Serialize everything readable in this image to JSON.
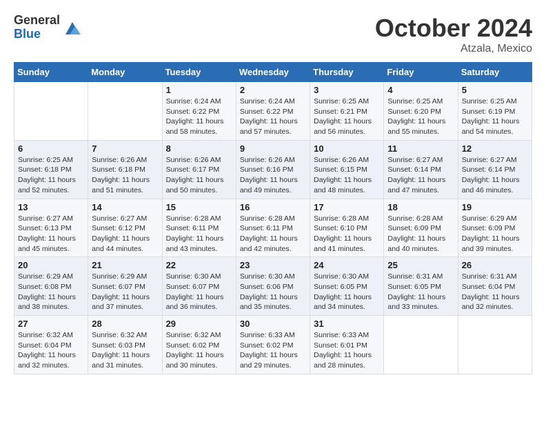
{
  "logo": {
    "general": "General",
    "blue": "Blue"
  },
  "title": "October 2024",
  "subtitle": "Atzala, Mexico",
  "weekdays": [
    "Sunday",
    "Monday",
    "Tuesday",
    "Wednesday",
    "Thursday",
    "Friday",
    "Saturday"
  ],
  "weeks": [
    [
      {
        "day": "",
        "info": ""
      },
      {
        "day": "",
        "info": ""
      },
      {
        "day": "1",
        "info": "Sunrise: 6:24 AM\nSunset: 6:22 PM\nDaylight: 11 hours and 58 minutes."
      },
      {
        "day": "2",
        "info": "Sunrise: 6:24 AM\nSunset: 6:22 PM\nDaylight: 11 hours and 57 minutes."
      },
      {
        "day": "3",
        "info": "Sunrise: 6:25 AM\nSunset: 6:21 PM\nDaylight: 11 hours and 56 minutes."
      },
      {
        "day": "4",
        "info": "Sunrise: 6:25 AM\nSunset: 6:20 PM\nDaylight: 11 hours and 55 minutes."
      },
      {
        "day": "5",
        "info": "Sunrise: 6:25 AM\nSunset: 6:19 PM\nDaylight: 11 hours and 54 minutes."
      }
    ],
    [
      {
        "day": "6",
        "info": "Sunrise: 6:25 AM\nSunset: 6:18 PM\nDaylight: 11 hours and 52 minutes."
      },
      {
        "day": "7",
        "info": "Sunrise: 6:26 AM\nSunset: 6:18 PM\nDaylight: 11 hours and 51 minutes."
      },
      {
        "day": "8",
        "info": "Sunrise: 6:26 AM\nSunset: 6:17 PM\nDaylight: 11 hours and 50 minutes."
      },
      {
        "day": "9",
        "info": "Sunrise: 6:26 AM\nSunset: 6:16 PM\nDaylight: 11 hours and 49 minutes."
      },
      {
        "day": "10",
        "info": "Sunrise: 6:26 AM\nSunset: 6:15 PM\nDaylight: 11 hours and 48 minutes."
      },
      {
        "day": "11",
        "info": "Sunrise: 6:27 AM\nSunset: 6:14 PM\nDaylight: 11 hours and 47 minutes."
      },
      {
        "day": "12",
        "info": "Sunrise: 6:27 AM\nSunset: 6:14 PM\nDaylight: 11 hours and 46 minutes."
      }
    ],
    [
      {
        "day": "13",
        "info": "Sunrise: 6:27 AM\nSunset: 6:13 PM\nDaylight: 11 hours and 45 minutes."
      },
      {
        "day": "14",
        "info": "Sunrise: 6:27 AM\nSunset: 6:12 PM\nDaylight: 11 hours and 44 minutes."
      },
      {
        "day": "15",
        "info": "Sunrise: 6:28 AM\nSunset: 6:11 PM\nDaylight: 11 hours and 43 minutes."
      },
      {
        "day": "16",
        "info": "Sunrise: 6:28 AM\nSunset: 6:11 PM\nDaylight: 11 hours and 42 minutes."
      },
      {
        "day": "17",
        "info": "Sunrise: 6:28 AM\nSunset: 6:10 PM\nDaylight: 11 hours and 41 minutes."
      },
      {
        "day": "18",
        "info": "Sunrise: 6:28 AM\nSunset: 6:09 PM\nDaylight: 11 hours and 40 minutes."
      },
      {
        "day": "19",
        "info": "Sunrise: 6:29 AM\nSunset: 6:09 PM\nDaylight: 11 hours and 39 minutes."
      }
    ],
    [
      {
        "day": "20",
        "info": "Sunrise: 6:29 AM\nSunset: 6:08 PM\nDaylight: 11 hours and 38 minutes."
      },
      {
        "day": "21",
        "info": "Sunrise: 6:29 AM\nSunset: 6:07 PM\nDaylight: 11 hours and 37 minutes."
      },
      {
        "day": "22",
        "info": "Sunrise: 6:30 AM\nSunset: 6:07 PM\nDaylight: 11 hours and 36 minutes."
      },
      {
        "day": "23",
        "info": "Sunrise: 6:30 AM\nSunset: 6:06 PM\nDaylight: 11 hours and 35 minutes."
      },
      {
        "day": "24",
        "info": "Sunrise: 6:30 AM\nSunset: 6:05 PM\nDaylight: 11 hours and 34 minutes."
      },
      {
        "day": "25",
        "info": "Sunrise: 6:31 AM\nSunset: 6:05 PM\nDaylight: 11 hours and 33 minutes."
      },
      {
        "day": "26",
        "info": "Sunrise: 6:31 AM\nSunset: 6:04 PM\nDaylight: 11 hours and 32 minutes."
      }
    ],
    [
      {
        "day": "27",
        "info": "Sunrise: 6:32 AM\nSunset: 6:04 PM\nDaylight: 11 hours and 32 minutes."
      },
      {
        "day": "28",
        "info": "Sunrise: 6:32 AM\nSunset: 6:03 PM\nDaylight: 11 hours and 31 minutes."
      },
      {
        "day": "29",
        "info": "Sunrise: 6:32 AM\nSunset: 6:02 PM\nDaylight: 11 hours and 30 minutes."
      },
      {
        "day": "30",
        "info": "Sunrise: 6:33 AM\nSunset: 6:02 PM\nDaylight: 11 hours and 29 minutes."
      },
      {
        "day": "31",
        "info": "Sunrise: 6:33 AM\nSunset: 6:01 PM\nDaylight: 11 hours and 28 minutes."
      },
      {
        "day": "",
        "info": ""
      },
      {
        "day": "",
        "info": ""
      }
    ]
  ]
}
